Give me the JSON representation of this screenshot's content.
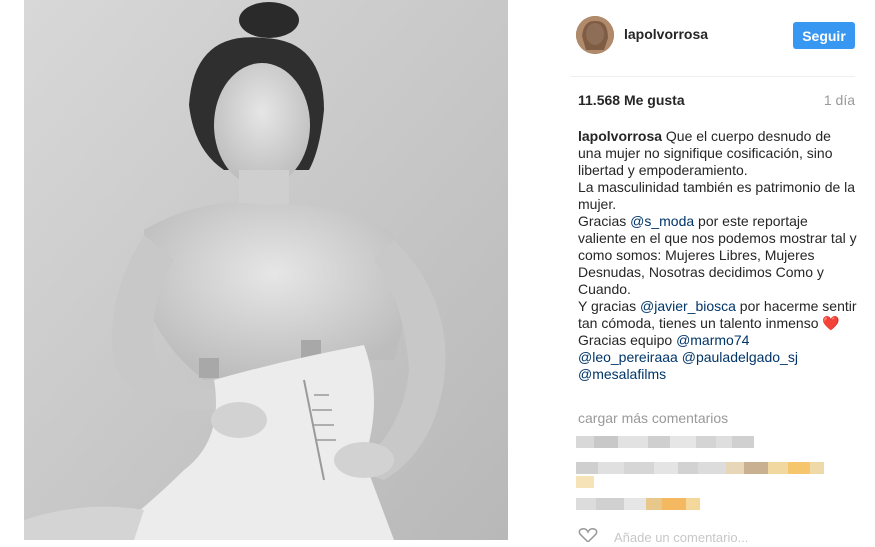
{
  "post": {
    "username": "lapolvorrosa",
    "follow_label": "Seguir",
    "likes": "11.568 Me gusta",
    "time": "1 día",
    "load_more": "cargar más comentarios",
    "add_comment_placeholder": "Añade un comentario..."
  },
  "caption": {
    "author": "lapolvorrosa",
    "line1": " Que el cuerpo desnudo de una mujer no signifique cosificación, sino libertad y empoderamiento.",
    "line2": "La masculinidad también es patrimonio de la mujer.",
    "line3_a": "Gracias ",
    "mention1": "@s_moda",
    "line3_b": " por este reportaje valiente en el que nos podemos mostrar tal y como somos: Mujeres Libres, Mujeres Desnudas, Nosotras decidimos Como y Cuando.",
    "line4_a": "Y gracias ",
    "mention2": "@javier_biosca",
    "line4_b": " por hacerme sentir tan cómoda, tienes un talento inmenso ",
    "heart": "❤️",
    "line5_a": "Gracias equipo ",
    "mention3": "@marmo74",
    "mention4": "@leo_pereiraaa",
    "mention5": "@pauladelgado_sj",
    "mention6": "@mesalafilms"
  },
  "colors": {
    "follow_button": "#3897f0",
    "mention": "#003569",
    "muted": "#999999"
  },
  "icons": {
    "like": "heart-outline-icon"
  }
}
